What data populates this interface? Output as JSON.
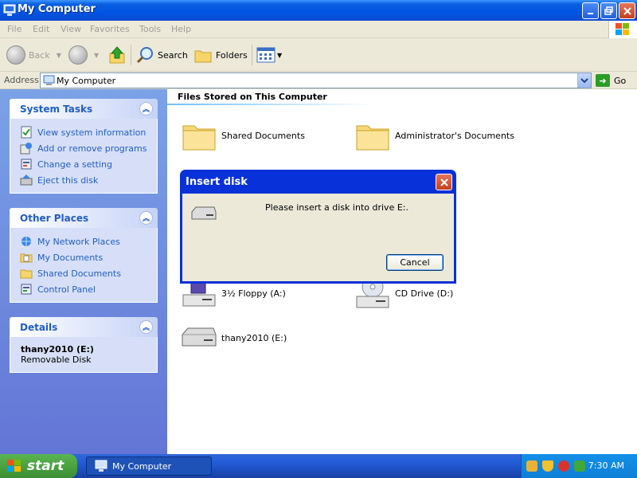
{
  "window": {
    "title": "My Computer",
    "icons": {
      "app": "computer-icon",
      "minimize": "minimize-icon",
      "maximize": "maximize-icon",
      "close": "close-icon"
    }
  },
  "menu": [
    "File",
    "Edit",
    "View",
    "Favorites",
    "Tools",
    "Help"
  ],
  "toolbar": {
    "back": "Back",
    "search": "Search",
    "folders": "Folders"
  },
  "address": {
    "label": "Address",
    "value": "My Computer",
    "go": "Go"
  },
  "system_tasks": {
    "title": "System Tasks",
    "items": [
      {
        "label": "View system information",
        "icon": "system-info-icon"
      },
      {
        "label": "Add or remove programs",
        "icon": "add-remove-programs-icon"
      },
      {
        "label": "Change a setting",
        "icon": "control-panel-icon"
      },
      {
        "label": "Eject this disk",
        "icon": "eject-icon"
      }
    ]
  },
  "other_places": {
    "title": "Other Places",
    "items": [
      {
        "label": "My Network Places",
        "icon": "network-icon"
      },
      {
        "label": "My Documents",
        "icon": "documents-icon"
      },
      {
        "label": "Shared Documents",
        "icon": "folder-icon"
      },
      {
        "label": "Control Panel",
        "icon": "control-panel-icon"
      }
    ]
  },
  "details": {
    "title": "Details",
    "name": "thany2010 (E:)",
    "type": "Removable Disk"
  },
  "main": {
    "section_title": "Files Stored on This Computer",
    "items": [
      {
        "label": "Shared Documents",
        "icon": "folder-icon"
      },
      {
        "label": "Administrator's Documents",
        "icon": "folder-icon"
      },
      {
        "label": "3½ Floppy (A:)",
        "icon": "floppy-drive-icon"
      },
      {
        "label": "CD Drive (D:)",
        "icon": "cd-drive-icon"
      },
      {
        "label": "thany2010 (E:)",
        "icon": "removable-disk-icon"
      }
    ]
  },
  "dialog": {
    "title": "Insert disk",
    "message": "Please insert a disk into drive E:.",
    "cancel": "Cancel"
  },
  "taskbar": {
    "start": "start",
    "task": "My Computer",
    "clock": "7:30 AM"
  },
  "colors": {
    "titlebar": "#0054e3",
    "task_pane": "#6375d6",
    "link": "#215dc6",
    "start_green": "#3c8f33"
  }
}
